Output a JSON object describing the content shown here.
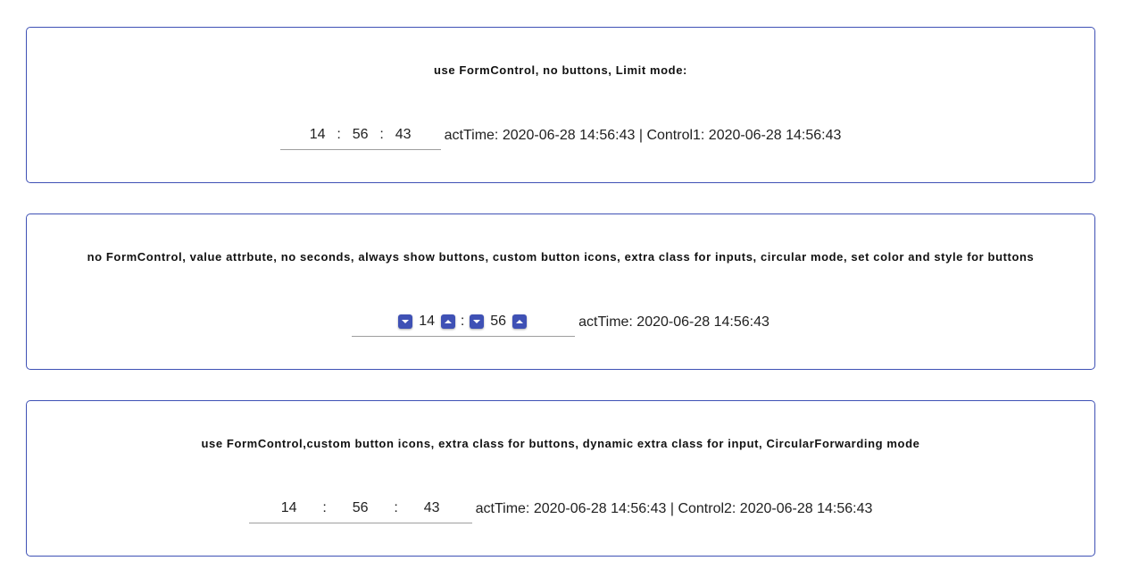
{
  "sections": [
    {
      "title": "use FormControl, no buttons, Limit mode:",
      "hours": "14",
      "minutes": "56",
      "seconds": "43",
      "separator": ":",
      "status": "actTime: 2020-06-28 14:56:43 | Control1: 2020-06-28 14:56:43"
    },
    {
      "title": "no FormControl, value attrbute, no seconds, always show buttons, custom button icons, extra class for inputs, circular mode, set color and style for buttons",
      "hours": "14",
      "minutes": "56",
      "separator": ":",
      "status": "actTime: 2020-06-28 14:56:43",
      "buttons": {
        "decrement_icon": "caret-down-icon",
        "increment_icon": "caret-up-icon",
        "color": "#3f51b5"
      }
    },
    {
      "title": "use FormControl,custom button icons, extra class for buttons, dynamic extra class for input, CircularForwarding mode",
      "hours": "14",
      "minutes": "56",
      "seconds": "43",
      "separator": ":",
      "status": "actTime: 2020-06-28 14:56:43 | Control2: 2020-06-28 14:56:43"
    }
  ],
  "theme": {
    "border_color": "#3f51b5",
    "underline_color": "#9e9e9e"
  }
}
